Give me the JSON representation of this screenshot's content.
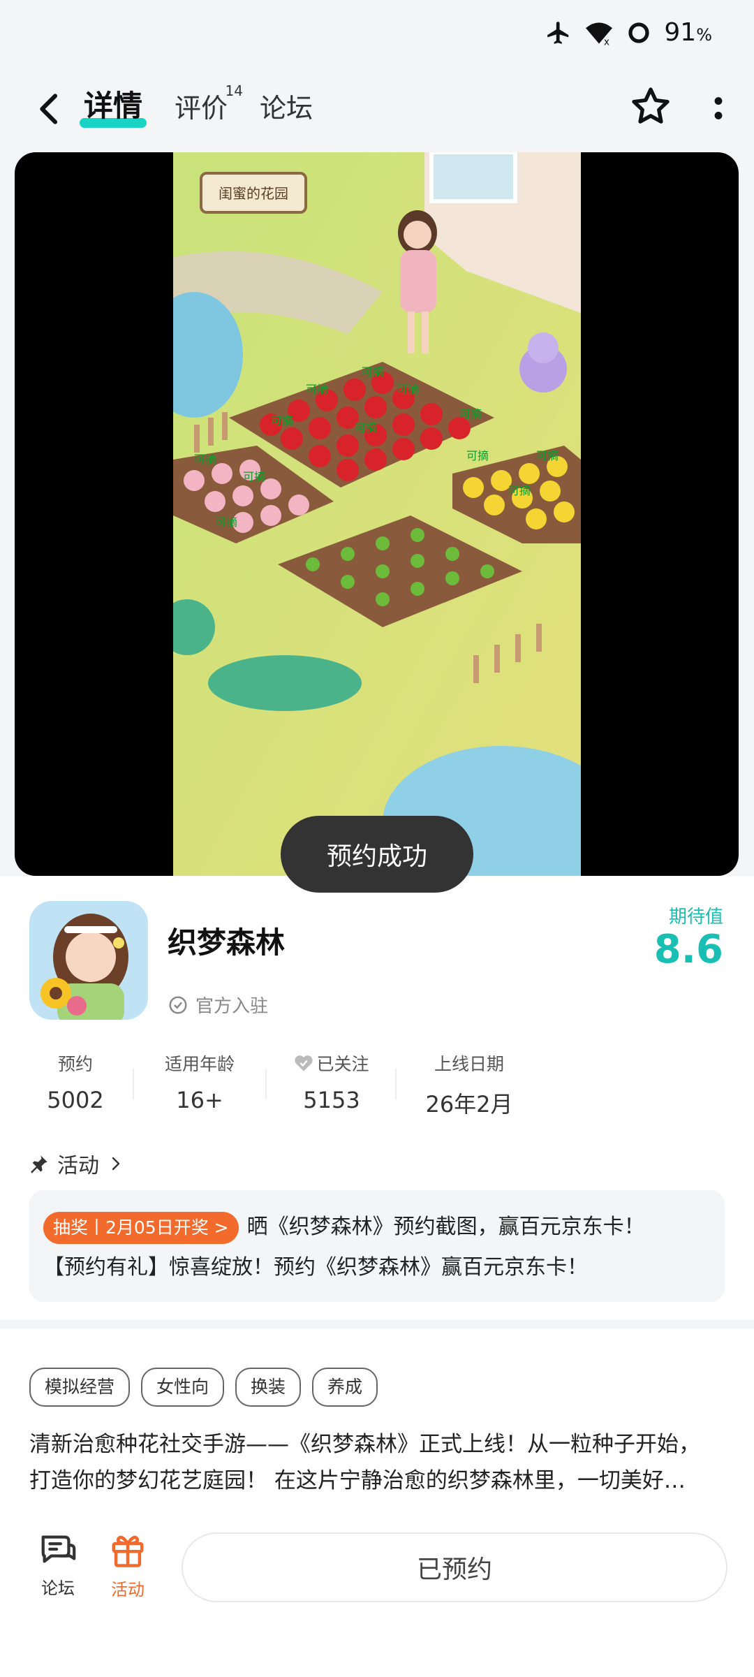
{
  "status": {
    "battery": "91",
    "battery_unit": "%"
  },
  "header": {
    "tabs": [
      {
        "label": "详情"
      },
      {
        "label": "评价",
        "badge": "14"
      },
      {
        "label": "论坛"
      }
    ]
  },
  "media": {
    "sign_text": "闺蜜的花园",
    "pick_label": "可摘"
  },
  "toast": "预约成功",
  "app": {
    "name": "织梦森林",
    "official": "官方入驻",
    "expect_label": "期待值",
    "expect_value": "8.6"
  },
  "stats": [
    {
      "label": "预约",
      "value": "5002"
    },
    {
      "label": "适用年龄",
      "value": "16+"
    },
    {
      "label": "已关注",
      "value": "5153"
    },
    {
      "label": "上线日期",
      "value": "26年2月"
    }
  ],
  "activity": {
    "title": "活动",
    "badge": "抽奖丨2月05日开奖 >",
    "line1": "晒《织梦森林》预约截图，赢百元京东卡！",
    "line2": "【预约有礼】惊喜绽放！预约《织梦森林》赢百元京东卡！"
  },
  "tags": [
    "模拟经营",
    "女性向",
    "换装",
    "养成"
  ],
  "description": {
    "line1": "清新治愈种花社交手游——《织梦森林》正式上线！从一粒种子开始，",
    "line2": "打造你的梦幻花艺庭园！ 在这片宁静治愈的织梦森林里，一切美好…"
  },
  "bottom": {
    "forum_label": "论坛",
    "activity_label": "活动",
    "reserve_label": "已预约"
  },
  "colors": {
    "accent": "#19d3c5",
    "orange": "#f26a2c"
  }
}
